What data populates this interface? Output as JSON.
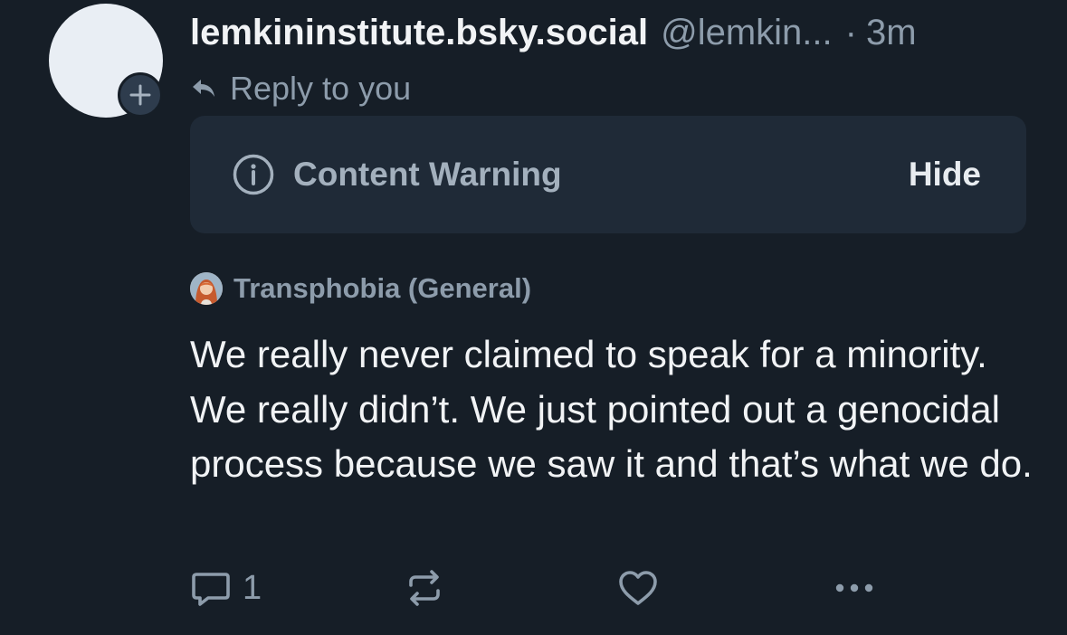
{
  "post": {
    "author": {
      "display_name": "lemkininstitute.bsky.social",
      "handle": "@lemkin...",
      "separator": "·",
      "timestamp": "3m"
    },
    "reply_context": "Reply to you",
    "content_warning": {
      "label": "Content Warning",
      "toggle_label": "Hide"
    },
    "moderation_label": "Transphobia (General)",
    "text": "We really never claimed to speak for a minority. We really didn’t. We just pointed out a genocidal process because we saw it and that’s what we do.",
    "actions": {
      "reply_count": "1"
    }
  },
  "colors": {
    "background": "#161e27",
    "panel": "#1f2a37",
    "muted_text": "#8d9cab",
    "primary_text": "#f1f3f5"
  },
  "icons": [
    "plus-icon",
    "reply-arrow-icon",
    "info-icon",
    "reply-bubble-icon",
    "repost-icon",
    "heart-icon",
    "more-dots-icon"
  ]
}
